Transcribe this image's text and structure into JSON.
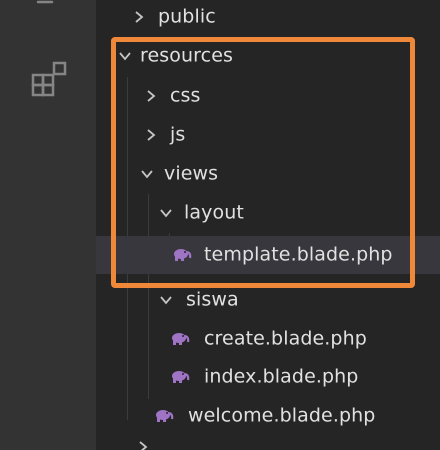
{
  "explorer": {
    "rows": [
      {
        "label": "public",
        "chevron": "right"
      },
      {
        "label": "resources",
        "chevron": "down"
      },
      {
        "label": "css",
        "chevron": "right"
      },
      {
        "label": "js",
        "chevron": "right"
      },
      {
        "label": "views",
        "chevron": "down"
      },
      {
        "label": "layout",
        "chevron": "down"
      },
      {
        "label": "template.blade.php",
        "icon": "php-elephant-icon",
        "selected": true
      },
      {
        "label": "siswa",
        "chevron": "down"
      },
      {
        "label": "create.blade.php",
        "icon": "php-elephant-icon"
      },
      {
        "label": "index.blade.php",
        "icon": "php-elephant-icon"
      },
      {
        "label": "welcome.blade.php",
        "icon": "php-elephant-icon"
      }
    ]
  },
  "colors": {
    "highlight": "#f0883a",
    "php_icon": "#a074c4",
    "text": "#e1e1e1",
    "selected_row": "#37373d"
  }
}
